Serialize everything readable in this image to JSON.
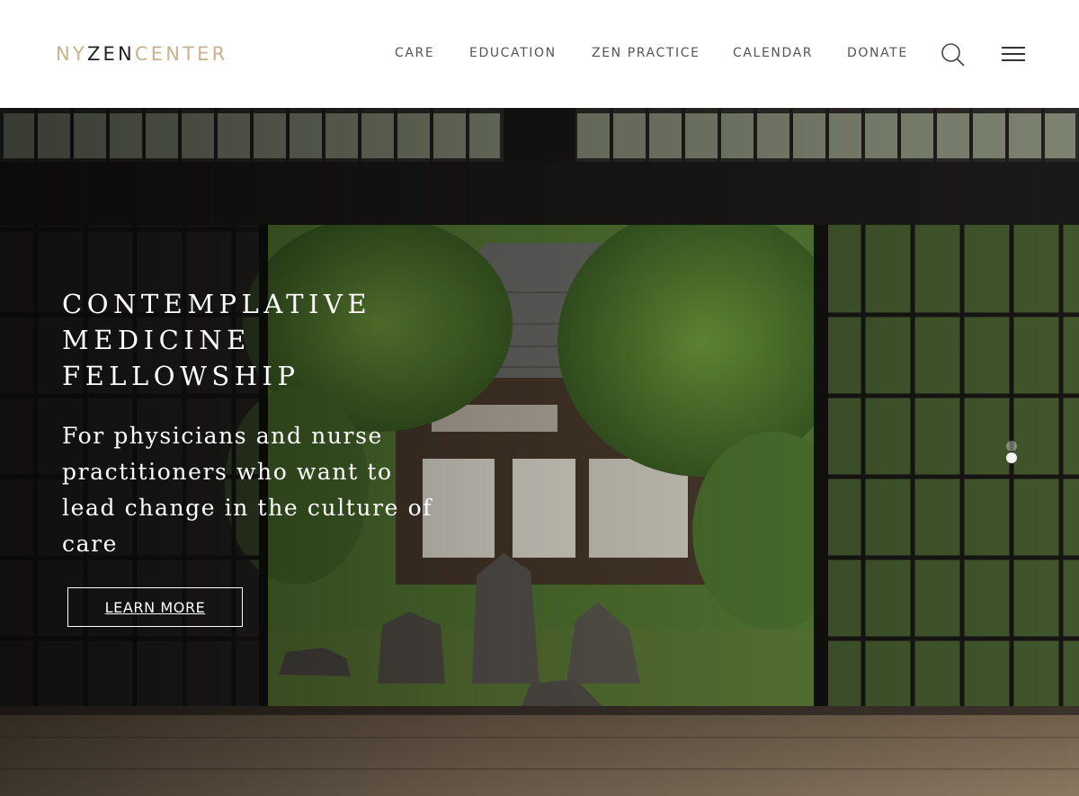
{
  "logo": {
    "ny": "NY",
    "zen": "ZEN",
    "center": "CENTER"
  },
  "nav": {
    "items": [
      {
        "label": "CARE"
      },
      {
        "label": "EDUCATION"
      },
      {
        "label": "ZEN PRACTICE"
      },
      {
        "label": "CALENDAR"
      },
      {
        "label": "DONATE"
      }
    ],
    "search_icon": "search-icon",
    "menu_icon": "hamburger-menu-icon"
  },
  "hero": {
    "title_lines": [
      "CONTEMPLATIVE",
      "MEDICINE",
      "FELLOWSHIP"
    ],
    "subtitle": "For physicians and nurse practitioners who want to lead change in the culture of care",
    "button_label": "LEARN MORE",
    "slides": {
      "count": 2,
      "active": 2
    },
    "image": "temple-courtyard-garden-through-shoji-doors"
  },
  "colors": {
    "logo_accent": "#c9b28c",
    "logo_dark": "#222222",
    "nav_text": "#555555",
    "hero_text": "#ffffff"
  }
}
